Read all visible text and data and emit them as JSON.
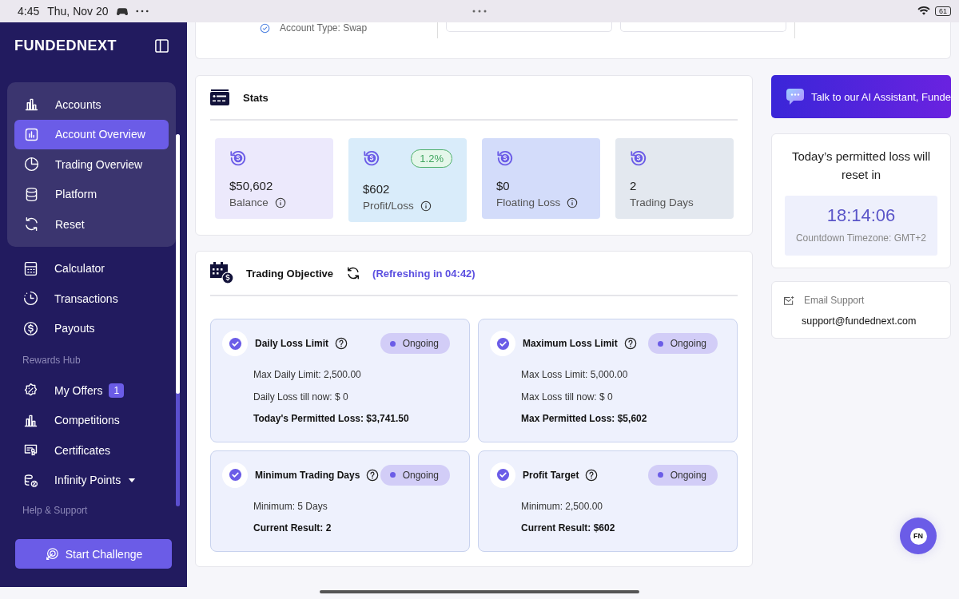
{
  "status_bar": {
    "time": "4:45",
    "date": "Thu, Nov 20",
    "battery": "61"
  },
  "sidebar": {
    "logo": "FUNDEDNEXT",
    "primary_items": [
      {
        "label": "Accounts",
        "selected": false
      },
      {
        "label": "Account Overview",
        "selected": true
      },
      {
        "label": "Trading Overview",
        "selected": false
      },
      {
        "label": "Platform",
        "selected": false
      },
      {
        "label": "Reset",
        "selected": false
      }
    ],
    "items": [
      {
        "label": "Calculator",
        "selected": false
      },
      {
        "label": "Transactions",
        "selected": false
      },
      {
        "label": "Payouts",
        "selected": false
      }
    ],
    "rewards_heading": "Rewards Hub",
    "rewards_items": [
      {
        "label": "My Offers",
        "selected": false,
        "badge": "1"
      },
      {
        "label": "Competitions",
        "selected": false
      },
      {
        "label": "Certificates",
        "selected": false
      },
      {
        "label": "Infinity Points",
        "selected": false,
        "expanded": false
      }
    ],
    "help_heading": "Help & Support",
    "start_button": "Start Challenge"
  },
  "account_card": {
    "account_type": "Account Type: Swap"
  },
  "stats": {
    "title": "Stats",
    "tiles": [
      {
        "value": "$50,602",
        "label": "Balance",
        "info": true,
        "color": "#ece9fc"
      },
      {
        "value": "$602",
        "label": "Profit/Loss",
        "info": true,
        "badge": "1.2%",
        "color": "#d9ecfa"
      },
      {
        "value": "$0",
        "label": "Floating Loss",
        "info": true,
        "color": "#d3dcfa"
      },
      {
        "value": "2",
        "label": "Trading Days",
        "info": false,
        "color": "#e3e8ef"
      }
    ]
  },
  "objectives": {
    "title": "Trading Objective",
    "refresh": "(Refreshing in 04:42)",
    "cards": [
      {
        "title": "Daily Loss Limit",
        "status": "Ongoing",
        "lines": [
          {
            "text": "Max Daily Limit: 2,500.00",
            "bold": false
          },
          {
            "text": "Daily Loss till now: $ 0",
            "bold": false
          },
          {
            "text": "Today's Permitted Loss: $3,741.50",
            "bold": true
          }
        ]
      },
      {
        "title": "Maximum Loss Limit",
        "status": "Ongoing",
        "lines": [
          {
            "text": "Max Loss Limit: 5,000.00",
            "bold": false
          },
          {
            "text": "Max Loss till now: $ 0",
            "bold": false
          },
          {
            "text": "Max Permitted Loss: $5,602",
            "bold": true
          }
        ]
      },
      {
        "title": "Minimum Trading Days",
        "status": "Ongoing",
        "lines": [
          {
            "text": "Minimum:  5 Days",
            "bold": false
          },
          {
            "text": "Current Result: 2",
            "bold": true
          }
        ]
      },
      {
        "title": "Profit Target",
        "status": "Ongoing",
        "lines": [
          {
            "text": "Minimum: 2,500.00",
            "bold": false
          },
          {
            "text": "Current Result: $602",
            "bold": true
          }
        ]
      }
    ]
  },
  "ai_button": "Talk to our AI Assistant, Funde",
  "countdown": {
    "heading": "Today’s permitted loss will reset in",
    "time": "18:14:06",
    "timezone": "Countdown Timezone: GMT+2"
  },
  "support": {
    "label": "Email Support",
    "email": "support@fundednext.com"
  },
  "chat_button": "FN"
}
